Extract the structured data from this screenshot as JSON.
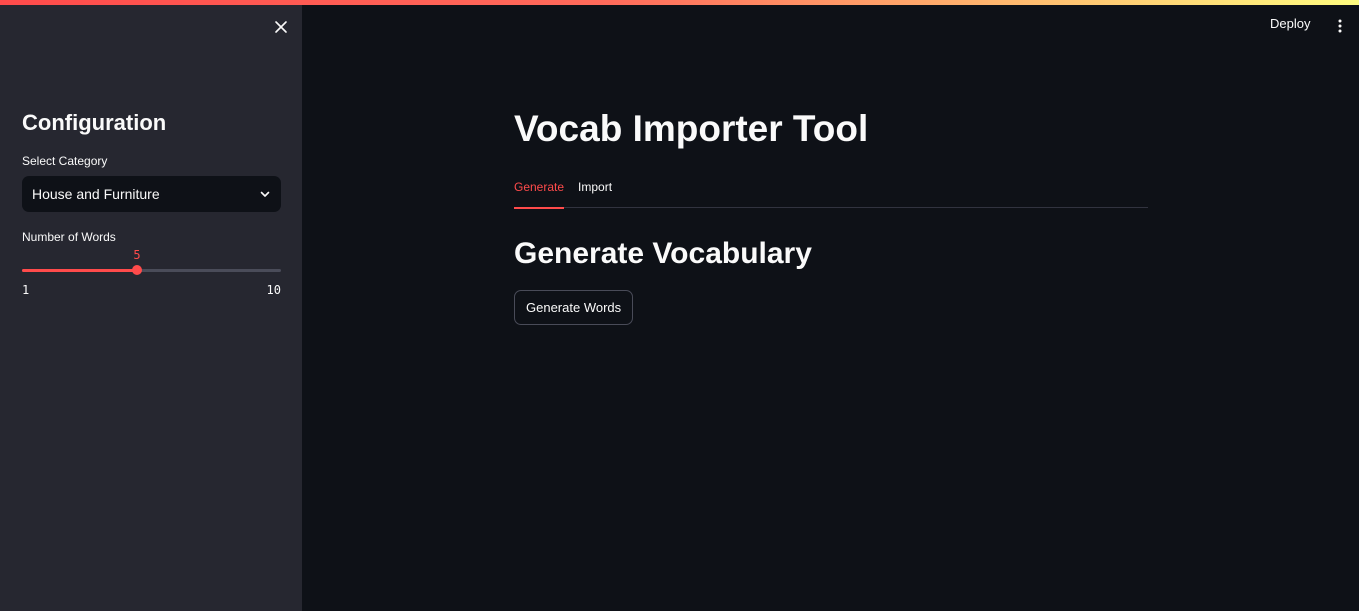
{
  "colors": {
    "background": "#0e1117",
    "sidebar": "#262730",
    "accent": "#ff4b4b",
    "text": "#fafafa"
  },
  "header": {
    "deploy_label": "Deploy",
    "menu_icon": "vertical-dots-icon"
  },
  "sidebar": {
    "close_icon": "close-icon",
    "title": "Configuration",
    "category": {
      "label": "Select Category",
      "value": "House and Furniture",
      "icon": "chevron-down-icon"
    },
    "words": {
      "label": "Number of Words",
      "value": 5,
      "value_text": "5",
      "min": 1,
      "max": 10,
      "min_text": "1",
      "max_text": "10"
    }
  },
  "main": {
    "title": "Vocab Importer Tool",
    "tabs": [
      {
        "label": "Generate",
        "active": true
      },
      {
        "label": "Import",
        "active": false
      }
    ],
    "section_title": "Generate Vocabulary",
    "generate_button": "Generate Words"
  }
}
